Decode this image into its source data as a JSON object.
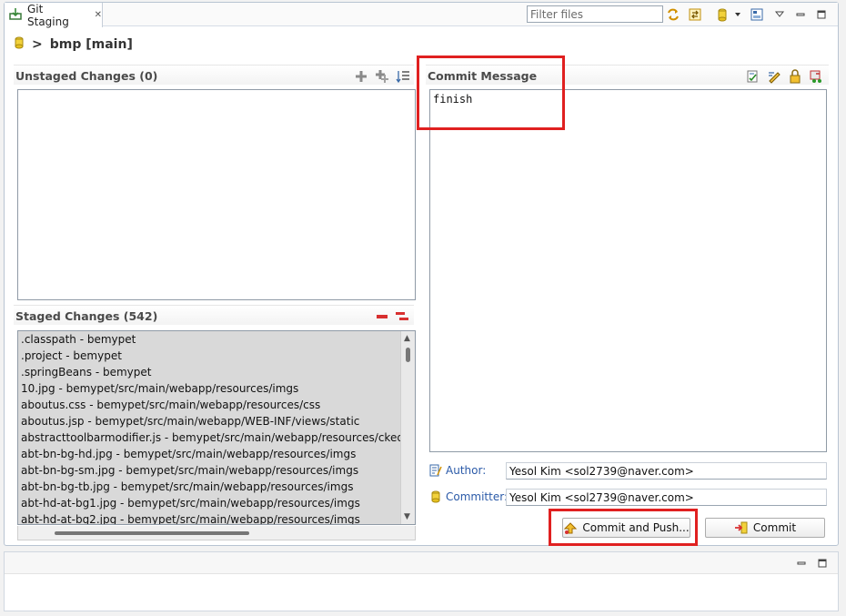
{
  "tab": {
    "title": "Git Staging",
    "close": "✕"
  },
  "filter": {
    "placeholder": "Filter files"
  },
  "repo": {
    "separator": ">",
    "name": "bmp [main]"
  },
  "unstaged": {
    "title": "Unstaged Changes (0)",
    "items": []
  },
  "staged": {
    "title": "Staged Changes (542)",
    "items": [
      ".classpath - bemypet",
      ".project - bemypet",
      ".springBeans - bemypet",
      "10.jpg - bemypet/src/main/webapp/resources/imgs",
      "aboutus.css - bemypet/src/main/webapp/resources/css",
      "aboutus.jsp - bemypet/src/main/webapp/WEB-INF/views/static",
      "abstracttoolbarmodifier.js - bemypet/src/main/webapp/resources/ckeditor/sa",
      "abt-bn-bg-hd.jpg - bemypet/src/main/webapp/resources/imgs",
      "abt-bn-bg-sm.jpg - bemypet/src/main/webapp/resources/imgs",
      "abt-bn-bg-tb.jpg - bemypet/src/main/webapp/resources/imgs",
      "abt-hd-at-bg1.jpg - bemypet/src/main/webapp/resources/imgs",
      "abt-hd-at-bg2.jpg - bemypet/src/main/webapp/resources/imgs"
    ]
  },
  "commit": {
    "title": "Commit Message",
    "message": "finish",
    "author_label": "Author:",
    "author_value": "Yesol Kim <sol2739@naver.com>",
    "committer_label": "Committer:",
    "committer_value": "Yesol Kim <sol2739@naver.com>",
    "commit_push_label": "Commit and Push...",
    "commit_label": "Commit"
  },
  "colors": {
    "highlight": "#e02020",
    "link": "#2b5aa8",
    "staged_bg": "#d9d9d9"
  }
}
